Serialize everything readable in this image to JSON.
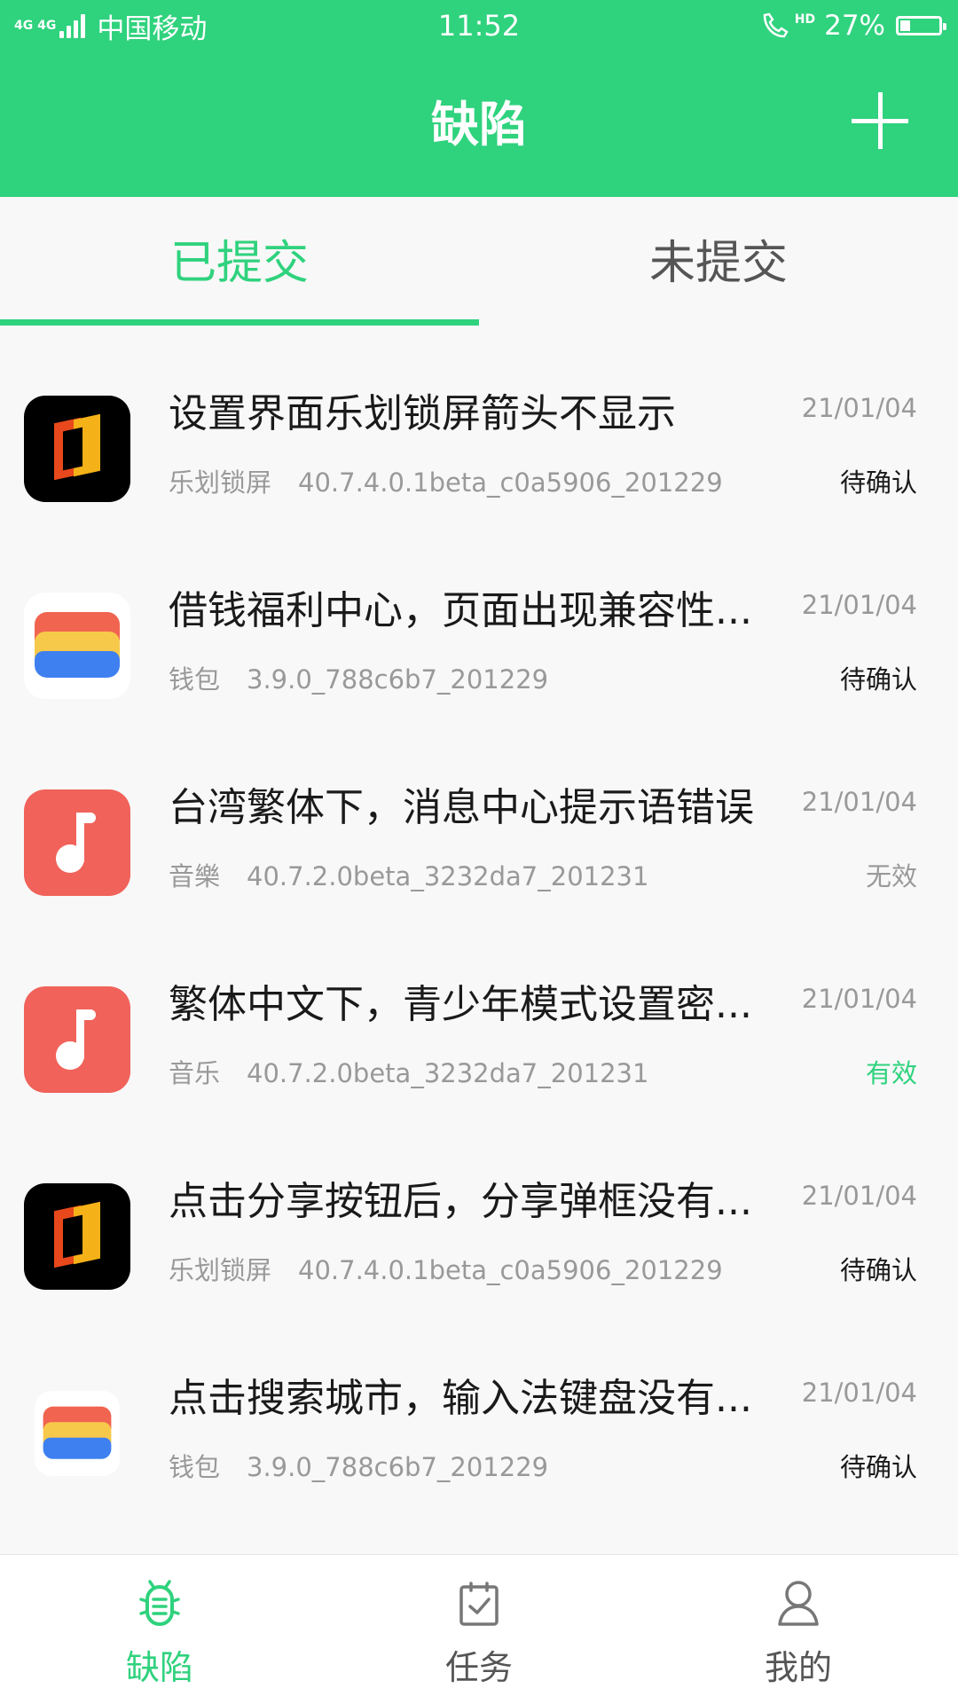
{
  "status_bar": {
    "network": "4G 4G",
    "carrier": "中国移动",
    "time": "11:52",
    "hd": "HD",
    "battery": "27%",
    "battery_level": 0.27
  },
  "header": {
    "title": "缺陷",
    "add_icon": "plus-icon"
  },
  "tabs": [
    {
      "label": "已提交",
      "active": true
    },
    {
      "label": "未提交",
      "active": false
    }
  ],
  "defects": [
    {
      "title": "设置界面乐划锁屏箭头不显示",
      "app": "乐划锁屏",
      "version": "40.7.4.0.1beta_c0a5906_201229",
      "date": "21/01/04",
      "status": "待确认",
      "icon": "lock-screen-app-icon"
    },
    {
      "title": "借钱福利中心，页面出现兼容性...",
      "app": "钱包",
      "version": "3.9.0_788c6b7_201229",
      "date": "21/01/04",
      "status": "待确认",
      "icon": "wallet-app-icon"
    },
    {
      "title": "台湾繁体下，消息中心提示语错误",
      "app": "音樂",
      "version": "40.7.2.0beta_3232da7_201231",
      "date": "21/01/04",
      "status": "无效",
      "icon": "music-app-icon"
    },
    {
      "title": "繁体中文下，青少年模式设置密...",
      "app": "音乐",
      "version": "40.7.2.0beta_3232da7_201231",
      "date": "21/01/04",
      "status": "有效",
      "icon": "music-app-icon"
    },
    {
      "title": "点击分享按钮后，分享弹框没有...",
      "app": "乐划锁屏",
      "version": "40.7.4.0.1beta_c0a5906_201229",
      "date": "21/01/04",
      "status": "待确认",
      "icon": "lock-screen-app-icon"
    },
    {
      "title": "点击搜索城市，输入法键盘没有...",
      "app": "钱包",
      "version": "3.9.0_788c6b7_201229",
      "date": "21/01/04",
      "status": "待确认",
      "icon": "wallet-app-icon"
    }
  ],
  "colors": {
    "accent": "#2fd27d",
    "valid": "#2fd27d",
    "invalid": "#999999",
    "pending": "#1a1a1a"
  },
  "bottom_nav": [
    {
      "label": "缺陷",
      "icon": "bug-icon",
      "active": true
    },
    {
      "label": "任务",
      "icon": "clipboard-check-icon",
      "active": false
    },
    {
      "label": "我的",
      "icon": "person-icon",
      "active": false
    }
  ]
}
